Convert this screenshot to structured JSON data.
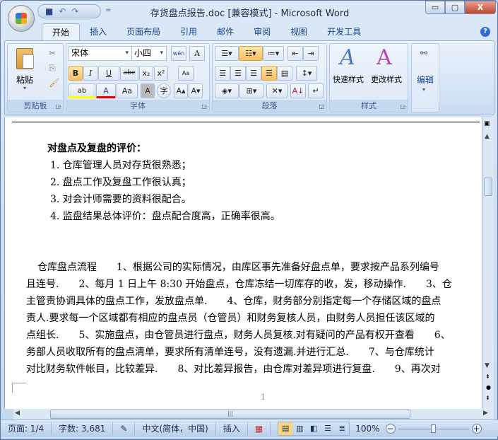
{
  "window": {
    "title": "存货盘点报告.doc [兼容模式] - Microsoft Word",
    "minimize": "▭",
    "restore": "▢",
    "close": "X"
  },
  "qat": {
    "save": "💾",
    "undo": "↶",
    "redo": "↷",
    "dropdown": "="
  },
  "tabs": [
    "开始",
    "插入",
    "页面布局",
    "引用",
    "邮件",
    "审阅",
    "视图",
    "开发工具"
  ],
  "help": "?",
  "ribbon": {
    "clipboard": {
      "label": "剪贴板",
      "paste": "粘贴"
    },
    "font": {
      "label": "字体",
      "font_name": "宋体",
      "font_size": "小四",
      "phonetic": "wén",
      "border_a": "A",
      "bold": "B",
      "italic": "I",
      "underline": "U",
      "strike": "abe",
      "sub": "x₂",
      "sup": "x²",
      "clear": "Aa",
      "highlight": "ab",
      "color": "A",
      "case": "Aa",
      "shade": "A",
      "enclose": "字",
      "grow": "A▴",
      "shrink": "A▾"
    },
    "paragraph": {
      "label": "段落"
    },
    "styles": {
      "label": "样式",
      "quick": "快速样式",
      "change": "更改样式"
    },
    "editing": {
      "label": "编辑"
    }
  },
  "document": {
    "heading": "对盘点及复盘的评价：",
    "list": [
      "1. 仓库管理人员对存货很熟悉；",
      "2. 盘点工作及复盘工作很认真；",
      "3. 对会计师需要的资料很配合。",
      "4. 监盘结果总体评价：盘点配合度高，正确率很高。"
    ],
    "paragraph": [
      "仓库盘点流程　　1、根据公司的实际情况，由库区事先准备好盘点单，要求按产品系列编号",
      "且连号.　　2、每月 1 日上午 8:30 开始盘点，仓库冻结一切库存的收，发，移动操作.　　3、仓",
      "主管责协调具体的盘点工作，发放盘点单.　　4、仓库，财务部分别指定每一个存储区域的盘点",
      "责人.要求每一个区域都有相应的盘点员（仓管员）和财务复核人员，由财务人员担任该区域的",
      "点组长.　　5、实施盘点，由仓管员进行盘点，财务人员复核.对有疑问的产品有权开查看　　6、",
      "务部人员收取所有的盘点清单，要求所有清单连号，没有遗漏.并进行汇总.　　7、与仓库统计",
      "对比财务软件帐目，比较差异.　　8、对比差异报告，由仓库对差异项进行复盘.　　9、再次对"
    ],
    "page_number": "1"
  },
  "status": {
    "page": "页面: 1/4",
    "words": "字数: 3,681",
    "language": "中文(简体，中国)",
    "mode": "插入",
    "zoom": "100%",
    "zoom_out": "−",
    "zoom_in": "+"
  }
}
